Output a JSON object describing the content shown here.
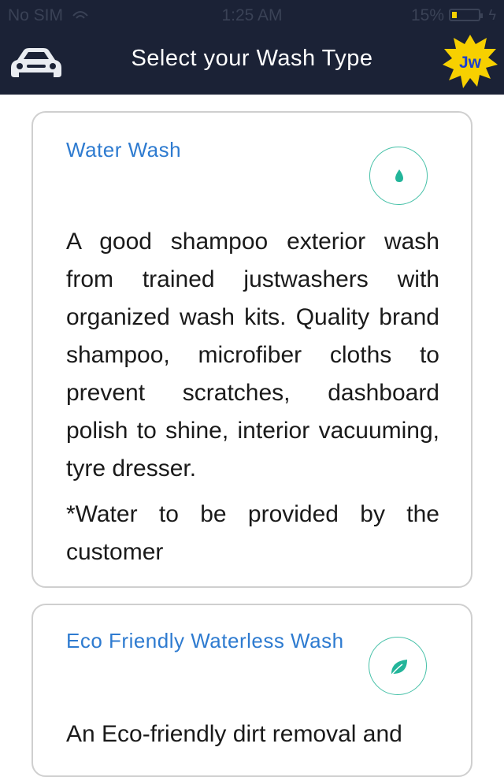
{
  "status_bar": {
    "carrier": "No SIM",
    "time": "1:25 AM",
    "battery": "15%"
  },
  "nav": {
    "title": "Select your Wash Type",
    "logo_text": "Jw"
  },
  "cards": [
    {
      "title": "Water Wash",
      "icon": "water-drop-icon",
      "description": "A good shampoo exterior wash from trained justwashers with organized wash kits. Quality brand shampoo, microfiber cloths to prevent scratches, dashboard polish to shine, interior vacuuming, tyre dresser.",
      "note": "*Water to be provided by the customer"
    },
    {
      "title": "Eco Friendly Waterless Wash",
      "icon": "leaf-icon",
      "description": "An Eco-friendly dirt removal and"
    }
  ],
  "colors": {
    "nav_bg": "#1b2236",
    "title_blue": "#2e7bd0",
    "icon_teal": "#47c1a8",
    "logo_yellow": "#f7d000"
  }
}
